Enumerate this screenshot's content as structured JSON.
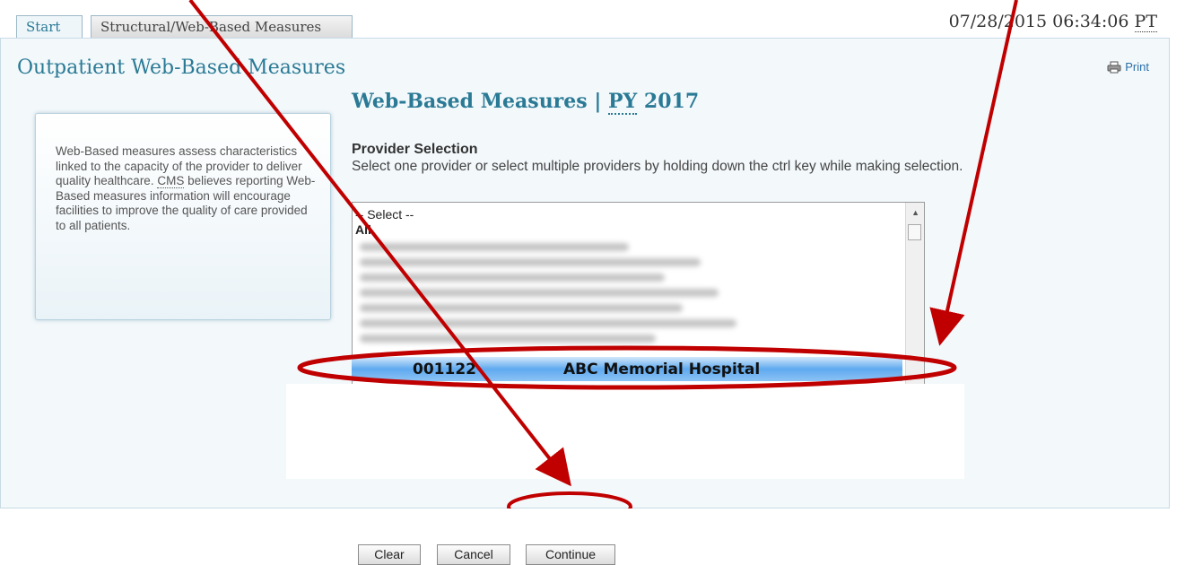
{
  "tabs": [
    {
      "label": "Start"
    },
    {
      "label": "Structural/Web-Based Measures"
    }
  ],
  "timestamp": {
    "datetime": "07/28/2015 06:34:06",
    "zone": "PT"
  },
  "page": {
    "title": "Outpatient Web-Based Measures",
    "print_label": "Print"
  },
  "section": {
    "title_main": "Web-Based Measures | ",
    "title_py": "PY",
    "title_year": " 2017"
  },
  "info": {
    "text_before": "Web-Based measures assess characteristics linked to the capacity of the provider to deliver quality healthcare. ",
    "cms": "CMS",
    "text_after": " believes reporting Web-Based measures information will encourage facilities to improve the quality of care provided to all patients."
  },
  "provider_selection": {
    "heading": "Provider Selection",
    "instructions": "Select one provider or select multiple providers by holding down the ctrl key while making selection.",
    "options": [
      "-- Select --",
      "All"
    ],
    "highlighted": {
      "code": "001122",
      "name": "ABC Memorial Hospital"
    }
  },
  "buttons": {
    "clear": "Clear",
    "cancel": "Cancel",
    "continue": "Continue"
  },
  "colors": {
    "accent": "#2a7a95",
    "annotation": "#c00000",
    "selection": "#5fa9ef"
  }
}
